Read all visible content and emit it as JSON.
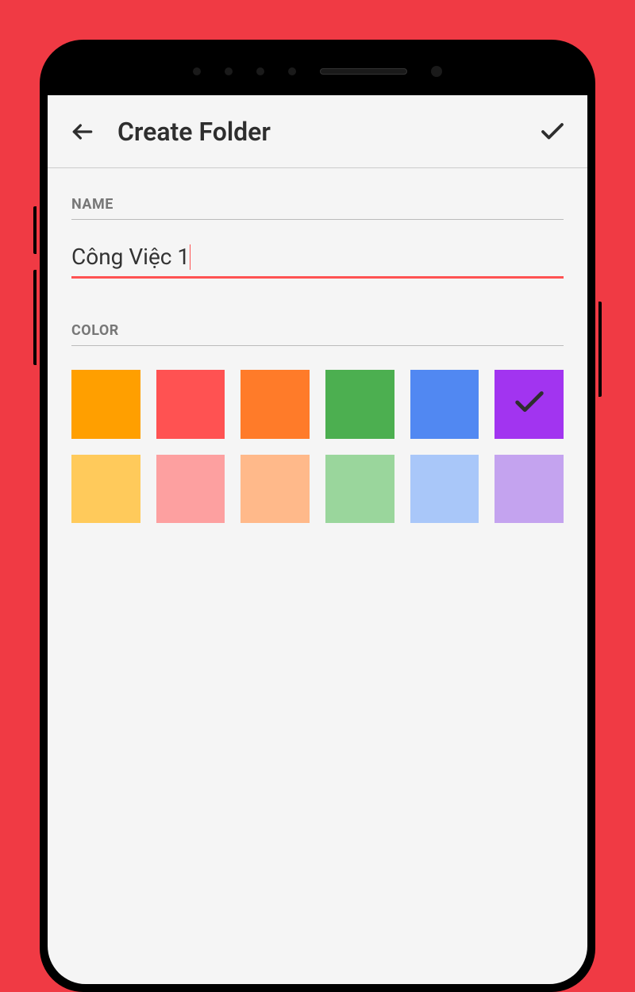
{
  "header": {
    "title": "Create Folder"
  },
  "labels": {
    "name": "NAME",
    "color": "COLOR"
  },
  "input": {
    "value": "Công Việc 1"
  },
  "colors": [
    {
      "hex": "#ff9f00",
      "selected": false
    },
    {
      "hex": "#ff5252",
      "selected": false
    },
    {
      "hex": "#ff7b29",
      "selected": false
    },
    {
      "hex": "#4caf50",
      "selected": false
    },
    {
      "hex": "#5188f2",
      "selected": false
    },
    {
      "hex": "#a234f0",
      "selected": true
    },
    {
      "hex": "#ffca5b",
      "selected": false
    },
    {
      "hex": "#fda0a0",
      "selected": false
    },
    {
      "hex": "#ffb98a",
      "selected": false
    },
    {
      "hex": "#9ad69c",
      "selected": false
    },
    {
      "hex": "#a9c7f9",
      "selected": false
    },
    {
      "hex": "#c4a3ef",
      "selected": false
    }
  ],
  "icons": {
    "back": "arrow-left",
    "confirm": "check"
  }
}
